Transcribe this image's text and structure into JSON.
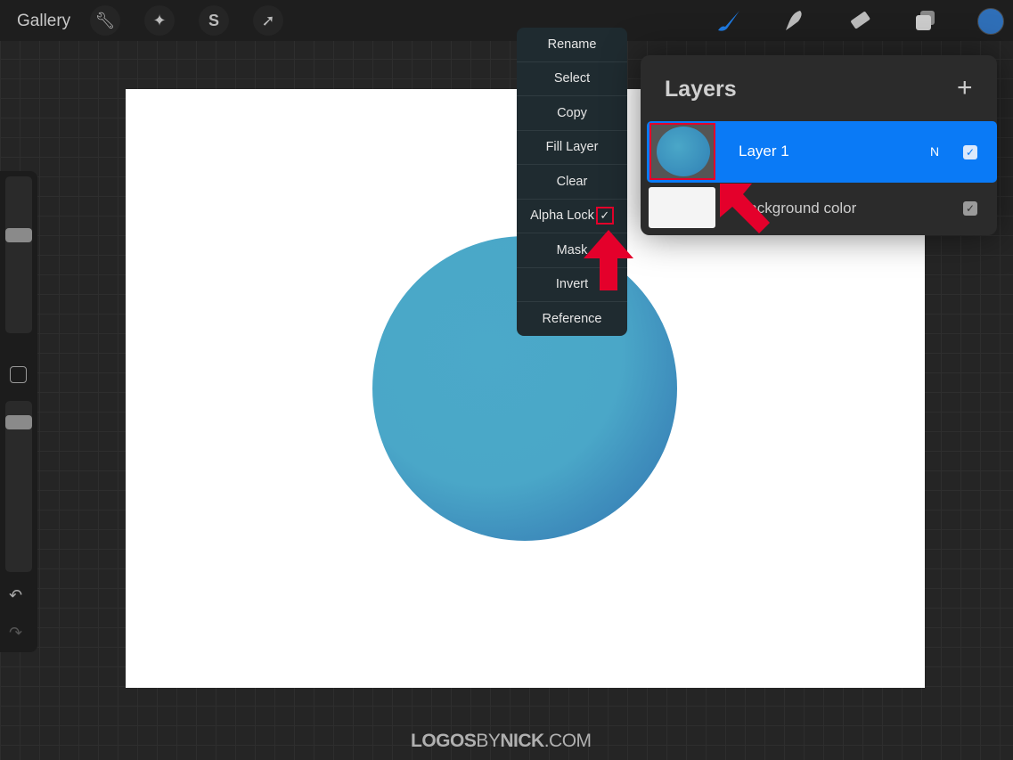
{
  "topbar": {
    "gallery_label": "Gallery",
    "left_tools": [
      {
        "icon": "wrench-icon"
      },
      {
        "icon": "magic-wand-icon"
      },
      {
        "icon": "selection-s-icon"
      },
      {
        "icon": "transform-arrow-icon"
      }
    ],
    "right_tools": [
      {
        "icon": "brush-icon"
      },
      {
        "icon": "smudge-icon"
      },
      {
        "icon": "eraser-icon"
      },
      {
        "icon": "layers-icon"
      }
    ],
    "current_color": "#2f6fb8"
  },
  "menu": {
    "items": [
      "Rename",
      "Select",
      "Copy",
      "Fill Layer",
      "Clear",
      "Alpha Lock",
      "Mask",
      "Invert",
      "Reference"
    ],
    "alpha_lock_checked": true,
    "check_mark": "✓"
  },
  "layers": {
    "title": "Layers",
    "add_icon": "+",
    "items": [
      {
        "name": "Layer 1",
        "blend": "N",
        "visible": true,
        "selected": true
      },
      {
        "name": "Background color",
        "visible": true,
        "selected": false
      }
    ]
  },
  "colors": {
    "accent": "#0a7af6",
    "annotation": "#e4002b"
  },
  "watermark": {
    "a": "LOGOS",
    "b": "BY",
    "c": "NICK",
    ".com": ".COM"
  }
}
